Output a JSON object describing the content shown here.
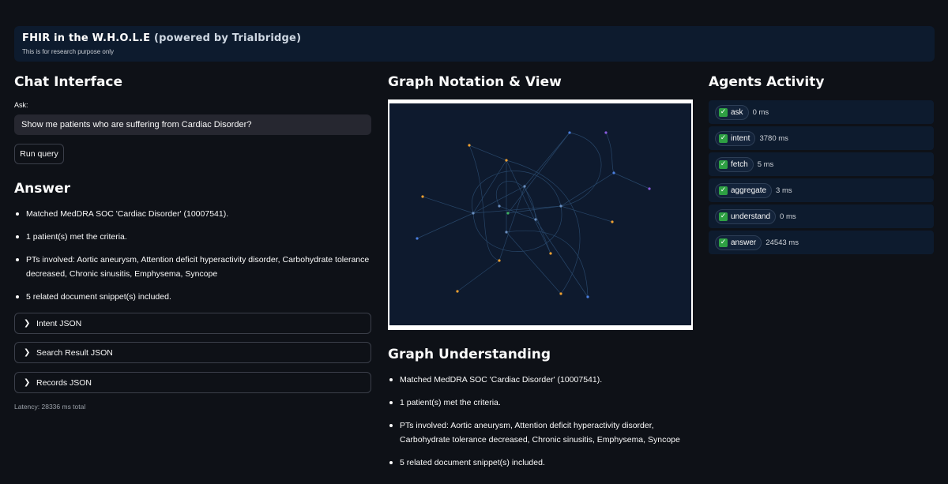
{
  "header": {
    "title_main": "FHIR in the W.H.O.L.E",
    "title_suffix": " (powered by Trialbridge)",
    "subtitle": "This is for research purpose only"
  },
  "chat": {
    "heading": "Chat Interface",
    "ask_label": "Ask:",
    "query_value": "Show me patients who are suffering from Cardiac Disorder?",
    "run_label": "Run query"
  },
  "answer": {
    "heading": "Answer",
    "items": [
      "Matched MedDRA SOC 'Cardiac Disorder' (10007541).",
      "1 patient(s) met the criteria.",
      "PTs involved: Aortic aneurysm, Attention deficit hyperactivity disorder, Carbohydrate tolerance decreased, Chronic sinusitis, Emphysema, Syncope",
      "5 related document snippet(s) included."
    ],
    "expanders": [
      "Intent JSON",
      "Search Result JSON",
      "Records JSON"
    ],
    "latency": "Latency: 28336 ms total"
  },
  "graph": {
    "heading": "Graph Notation & View",
    "colors": {
      "background": "#0e1a2e",
      "edge": "#2a4a6e",
      "orange": "#f0a030",
      "blue": "#4a7fe0",
      "purple": "#8a5ce0",
      "green": "#40b060"
    }
  },
  "understanding": {
    "heading": "Graph Understanding",
    "items": [
      "Matched MedDRA SOC 'Cardiac Disorder' (10007541).",
      "1 patient(s) met the criteria.",
      "PTs involved: Aortic aneurysm, Attention deficit hyperactivity disorder, Carbohydrate tolerance decreased, Chronic sinusitis, Emphysema, Syncope",
      "5 related document snippet(s) included."
    ]
  },
  "agents": {
    "heading": "Agents Activity",
    "items": [
      {
        "name": "ask",
        "ms": "0 ms"
      },
      {
        "name": "intent",
        "ms": "3780 ms"
      },
      {
        "name": "fetch",
        "ms": "5 ms"
      },
      {
        "name": "aggregate",
        "ms": "3 ms"
      },
      {
        "name": "understand",
        "ms": "0 ms"
      },
      {
        "name": "answer",
        "ms": "24543 ms"
      }
    ]
  }
}
